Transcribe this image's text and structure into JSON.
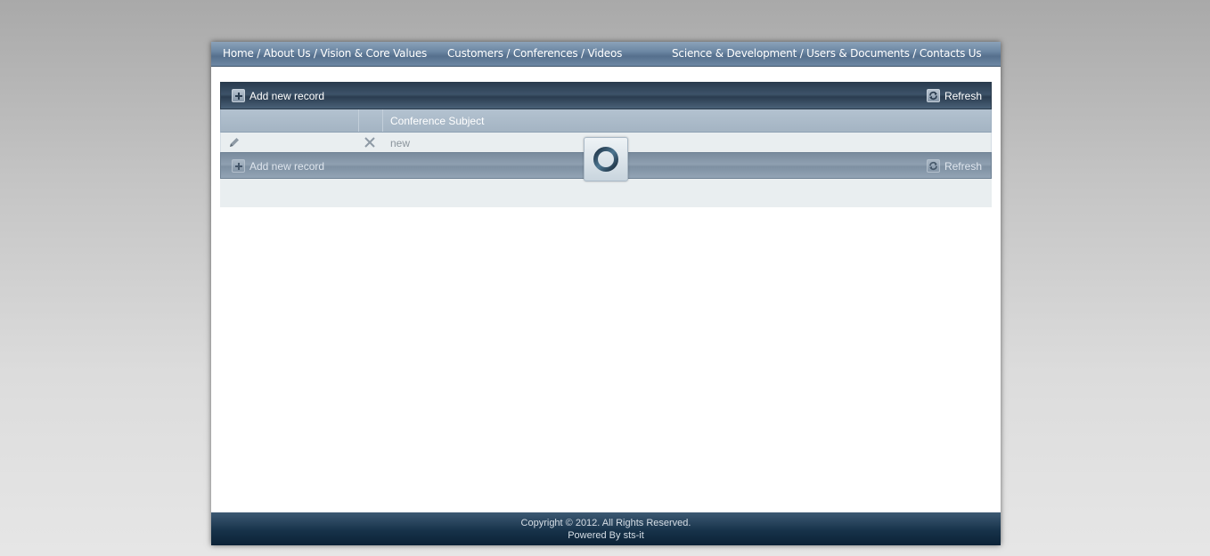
{
  "nav": {
    "group1": "Home / About Us / Vision & Core Values",
    "group2": "Customers / Conferences / Videos",
    "group3": "Science & Development / Users & Documents / Contacts Us"
  },
  "grid": {
    "top_toolbar": {
      "add_label": "Add new record",
      "refresh_label": "Refresh"
    },
    "columns": [
      "",
      "",
      "Conference Subject"
    ],
    "rows": [
      {
        "conference_subject": "new"
      }
    ],
    "bottom_toolbar": {
      "add_label": "Add new record",
      "refresh_label": "Refresh"
    },
    "loading": true
  },
  "icons": {
    "add": "plus-icon",
    "refresh": "refresh-icon",
    "edit": "pencil-icon",
    "delete": "close-icon",
    "loading": "spinner-icon"
  },
  "footer": {
    "copyright": "Copyright © 2012. All Rights Reserved.",
    "powered_by": "Powered By sts-it"
  }
}
